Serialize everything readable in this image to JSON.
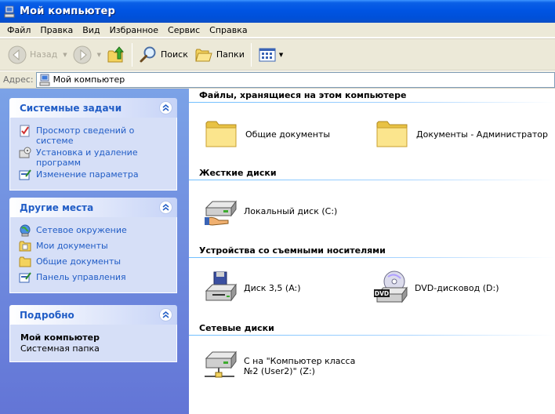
{
  "window": {
    "title": "Мой компьютер"
  },
  "menu": [
    "Файл",
    "Правка",
    "Вид",
    "Избранное",
    "Сервис",
    "Справка"
  ],
  "toolbar": {
    "back_label": "Назад",
    "search_label": "Поиск",
    "folders_label": "Папки"
  },
  "address": {
    "label": "Адрес:",
    "value": "Мой компьютер"
  },
  "left_pane": {
    "system_tasks": {
      "title": "Системные задачи",
      "items": [
        "Просмотр сведений о системе",
        "Установка и удаление программ",
        "Изменение параметра"
      ]
    },
    "other_places": {
      "title": "Другие места",
      "items": [
        "Сетевое окружение",
        "Мои документы",
        "Общие документы",
        "Панель управления"
      ]
    },
    "details": {
      "title": "Подробно",
      "name": "Мой компьютер",
      "type": "Системная папка"
    }
  },
  "content": {
    "groups": [
      {
        "header": "Файлы, хранящиеся на этом компьютере",
        "items": [
          "Общие документы",
          "Документы - Администратор"
        ]
      },
      {
        "header": "Жесткие диски",
        "items": [
          "Локальный диск (C:)"
        ]
      },
      {
        "header": "Устройства со съемными носителями",
        "items": [
          "Диск 3,5 (A:)",
          "DVD-дисковод (D:)"
        ]
      },
      {
        "header": "Сетевые диски",
        "items": [
          "С на \"Компьютер класса №2 (User2)\" (Z:)"
        ]
      }
    ],
    "dvd_badge": "DVD"
  }
}
